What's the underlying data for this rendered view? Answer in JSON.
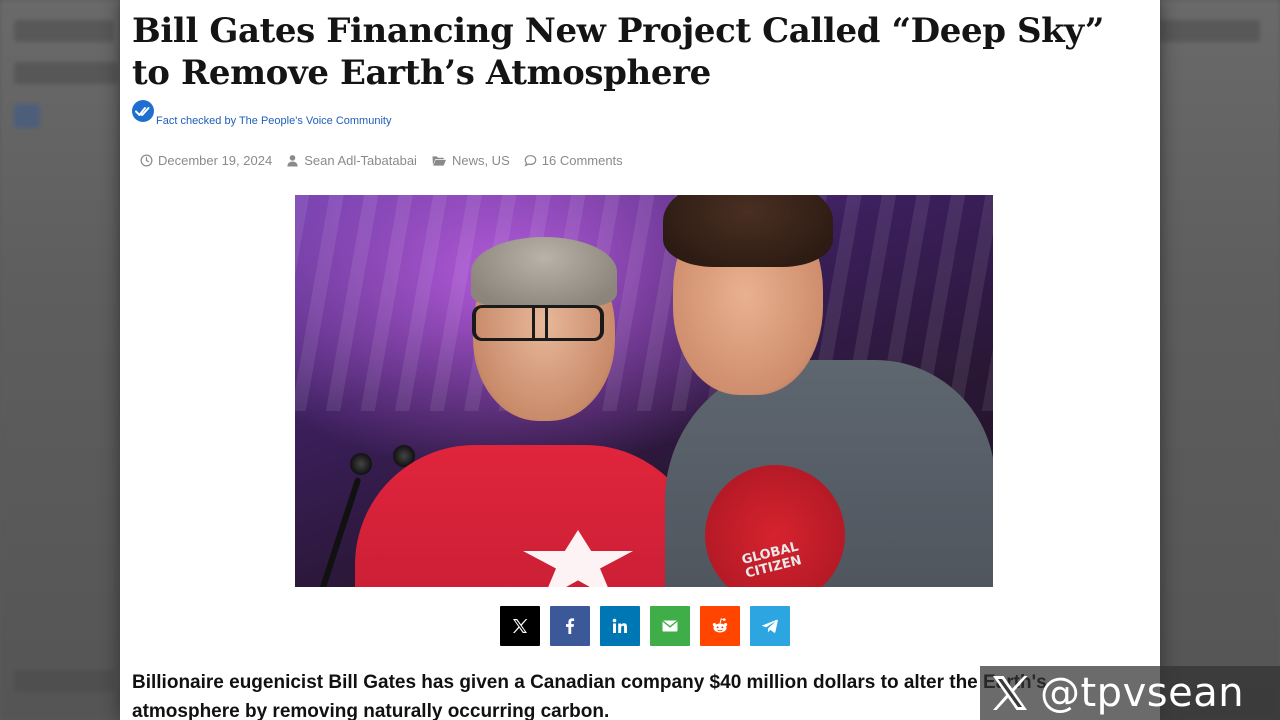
{
  "article": {
    "title": "Bill Gates Financing New Project Called “Deep Sky” to Remove Earth’s Atmosphere",
    "fact_check_text": "Fact checked by The People's Voice Community",
    "meta": {
      "date": "December 19, 2024",
      "author": "Sean Adl-Tabatabai",
      "categories": "News, US",
      "comments": "16 Comments"
    },
    "hero_image": {
      "shirt_text": "GLOBAL CITIZEN"
    },
    "share_buttons": [
      {
        "network": "x",
        "icon": "x-logo-icon",
        "color": "#000000"
      },
      {
        "network": "facebook",
        "icon": "facebook-icon",
        "color": "#3b5998"
      },
      {
        "network": "linkedin",
        "icon": "linkedin-icon",
        "color": "#0077b5"
      },
      {
        "network": "email",
        "icon": "email-icon",
        "color": "#3fae49"
      },
      {
        "network": "reddit",
        "icon": "reddit-icon",
        "color": "#ff4500"
      },
      {
        "network": "telegram",
        "icon": "telegram-icon",
        "color": "#2ca5e0"
      }
    ],
    "lead_paragraph": "Billionaire eugenicist Bill Gates has given a Canadian company $40 million dollars to alter the Earth's atmosphere by removing naturally occurring carbon."
  },
  "watermark": {
    "handle": "@tpvsean",
    "icon": "x-logo-icon"
  },
  "colors": {
    "fact_check_blue": "#1f6fd1",
    "meta_gray": "#8a8a8a",
    "title_text": "#141414"
  }
}
